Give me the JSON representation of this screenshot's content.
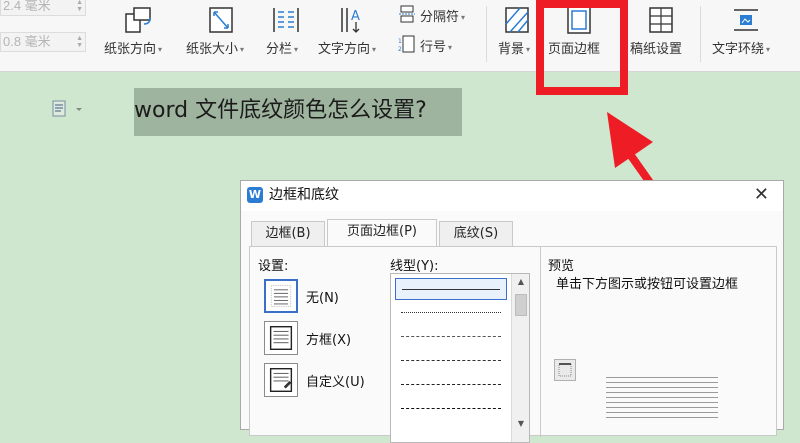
{
  "ribbon": {
    "margin_fields": [
      "2.4 毫米",
      "0.8 毫米"
    ],
    "buttons": [
      {
        "label": "纸张方向",
        "icon": "paper-orientation-icon"
      },
      {
        "label": "纸张大小",
        "icon": "paper-size-icon"
      },
      {
        "label": "分栏",
        "icon": "columns-icon"
      },
      {
        "label": "文字方向",
        "icon": "text-direction-icon"
      },
      {
        "label": "分隔符",
        "icon": "separator-icon"
      },
      {
        "label": "行号",
        "icon": "line-number-icon"
      },
      {
        "label": "背景",
        "icon": "background-icon"
      },
      {
        "label": "页面边框",
        "icon": "page-border-icon"
      },
      {
        "label": "稿纸设置",
        "icon": "manuscript-icon"
      },
      {
        "label": "文字环绕",
        "icon": "text-wrap-icon"
      }
    ],
    "highlight_color": "#ee1c25"
  },
  "document": {
    "text": "word 文件底纹颜色怎么设置?",
    "shading_color": "#9fb49f",
    "page_color": "#cfe6cf"
  },
  "dialog": {
    "title": "边框和底纹",
    "close": "✕",
    "tabs": [
      {
        "label": "边框(B)",
        "active": false
      },
      {
        "label": "页面边框(P)",
        "active": true
      },
      {
        "label": "底纹(S)",
        "active": false
      }
    ],
    "settings_label": "设置:",
    "settings": [
      {
        "label": "无(N)",
        "selected": true
      },
      {
        "label": "方框(X)",
        "selected": false
      },
      {
        "label": "自定义(U)",
        "selected": false
      }
    ],
    "line_style_label": "线型(Y):",
    "preview_label": "预览",
    "preview_hint": "单击下方图示或按钮可设置边框"
  }
}
